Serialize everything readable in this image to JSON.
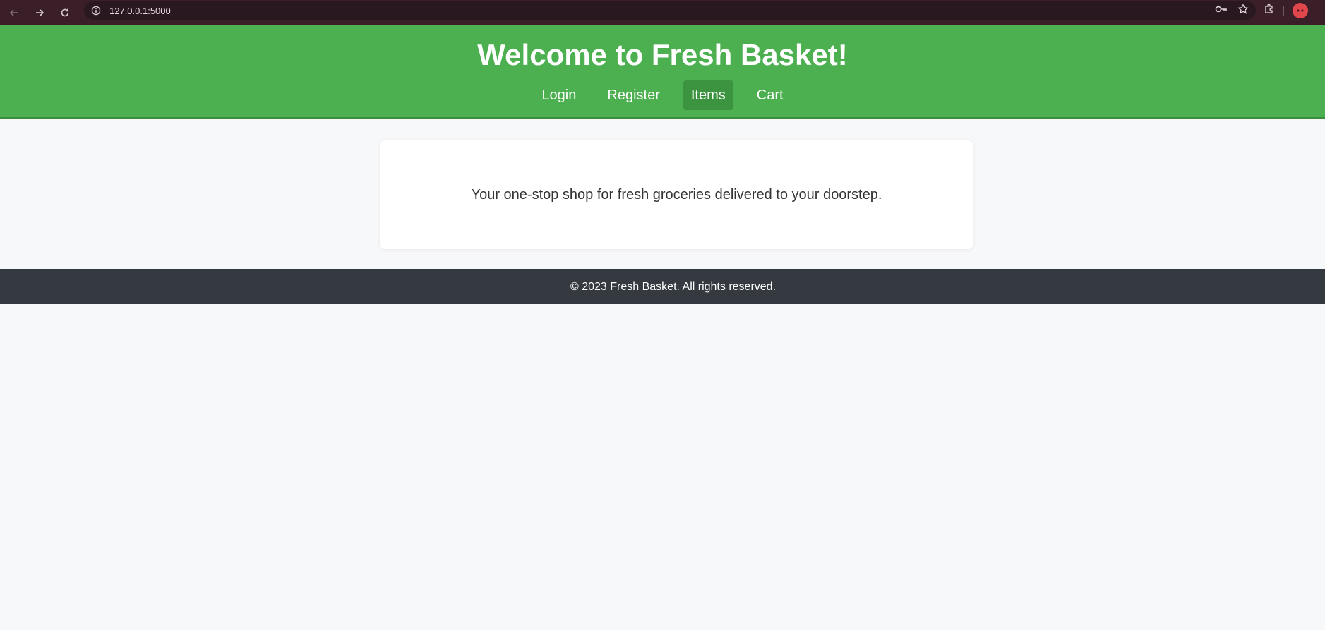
{
  "browser": {
    "url": "127.0.0.1:5000",
    "icons": [
      "back-icon",
      "forward-icon",
      "reload-icon",
      "site-info-icon",
      "password-key-icon",
      "bookmark-star-icon",
      "extensions-icon",
      "profile-avatar"
    ]
  },
  "header": {
    "title": "Welcome to Fresh Basket!",
    "background": "#4caf50",
    "nav": [
      {
        "label": "Login",
        "active": false
      },
      {
        "label": "Register",
        "active": false
      },
      {
        "label": "Items",
        "active": true
      },
      {
        "label": "Cart",
        "active": false
      }
    ]
  },
  "main": {
    "tagline": "Your one-stop shop for fresh groceries delivered to your doorstep."
  },
  "footer": {
    "text": "© 2023 Fresh Basket. All rights reserved.",
    "background": "#343a40"
  }
}
